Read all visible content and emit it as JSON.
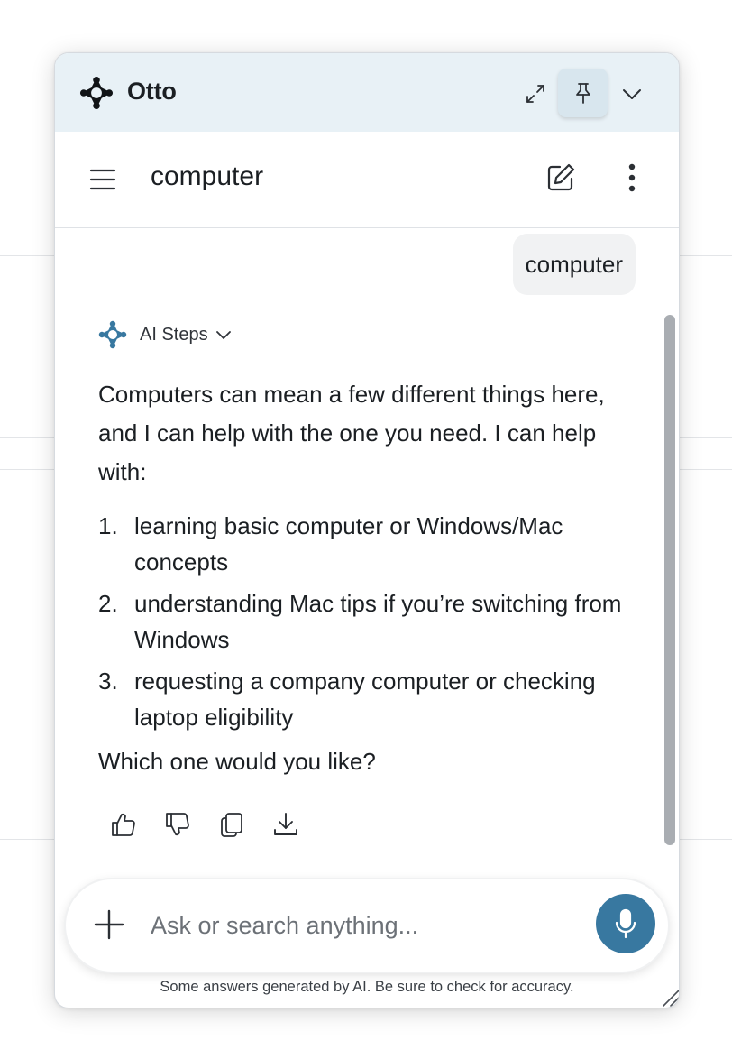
{
  "app": {
    "name": "Otto",
    "brand_color": "#3878a0",
    "titlebar_color": "#e8f1f6"
  },
  "titlebar": {
    "icons": [
      "expand-icon",
      "pin-icon",
      "chevron-down-icon"
    ]
  },
  "header": {
    "title": "computer",
    "icons": [
      "menu-icon",
      "edit-icon",
      "more-vertical-icon"
    ]
  },
  "conversation": {
    "user_message": "computer",
    "ai_steps_label": "AI Steps",
    "answer": {
      "intro": "Computers can mean a few different things here, and I can help with the one you need. I can help with:",
      "items": [
        {
          "num": "1.",
          "text": "learning basic computer or Windows/Mac concepts"
        },
        {
          "num": "2.",
          "text": "understanding Mac tips if you’re switching from Windows"
        },
        {
          "num": "3.",
          "text": "requesting a company computer or checking laptop eligibility"
        }
      ],
      "question": "Which one would you like?"
    },
    "actions": [
      "thumbs-up-icon",
      "thumbs-down-icon",
      "copy-icon",
      "download-icon"
    ]
  },
  "composer": {
    "placeholder": "Ask or search anything...",
    "value": "",
    "icons": [
      "plus-icon",
      "microphone-icon"
    ]
  },
  "footer": {
    "disclaimer": "Some answers generated by AI. Be sure to check for accuracy."
  }
}
